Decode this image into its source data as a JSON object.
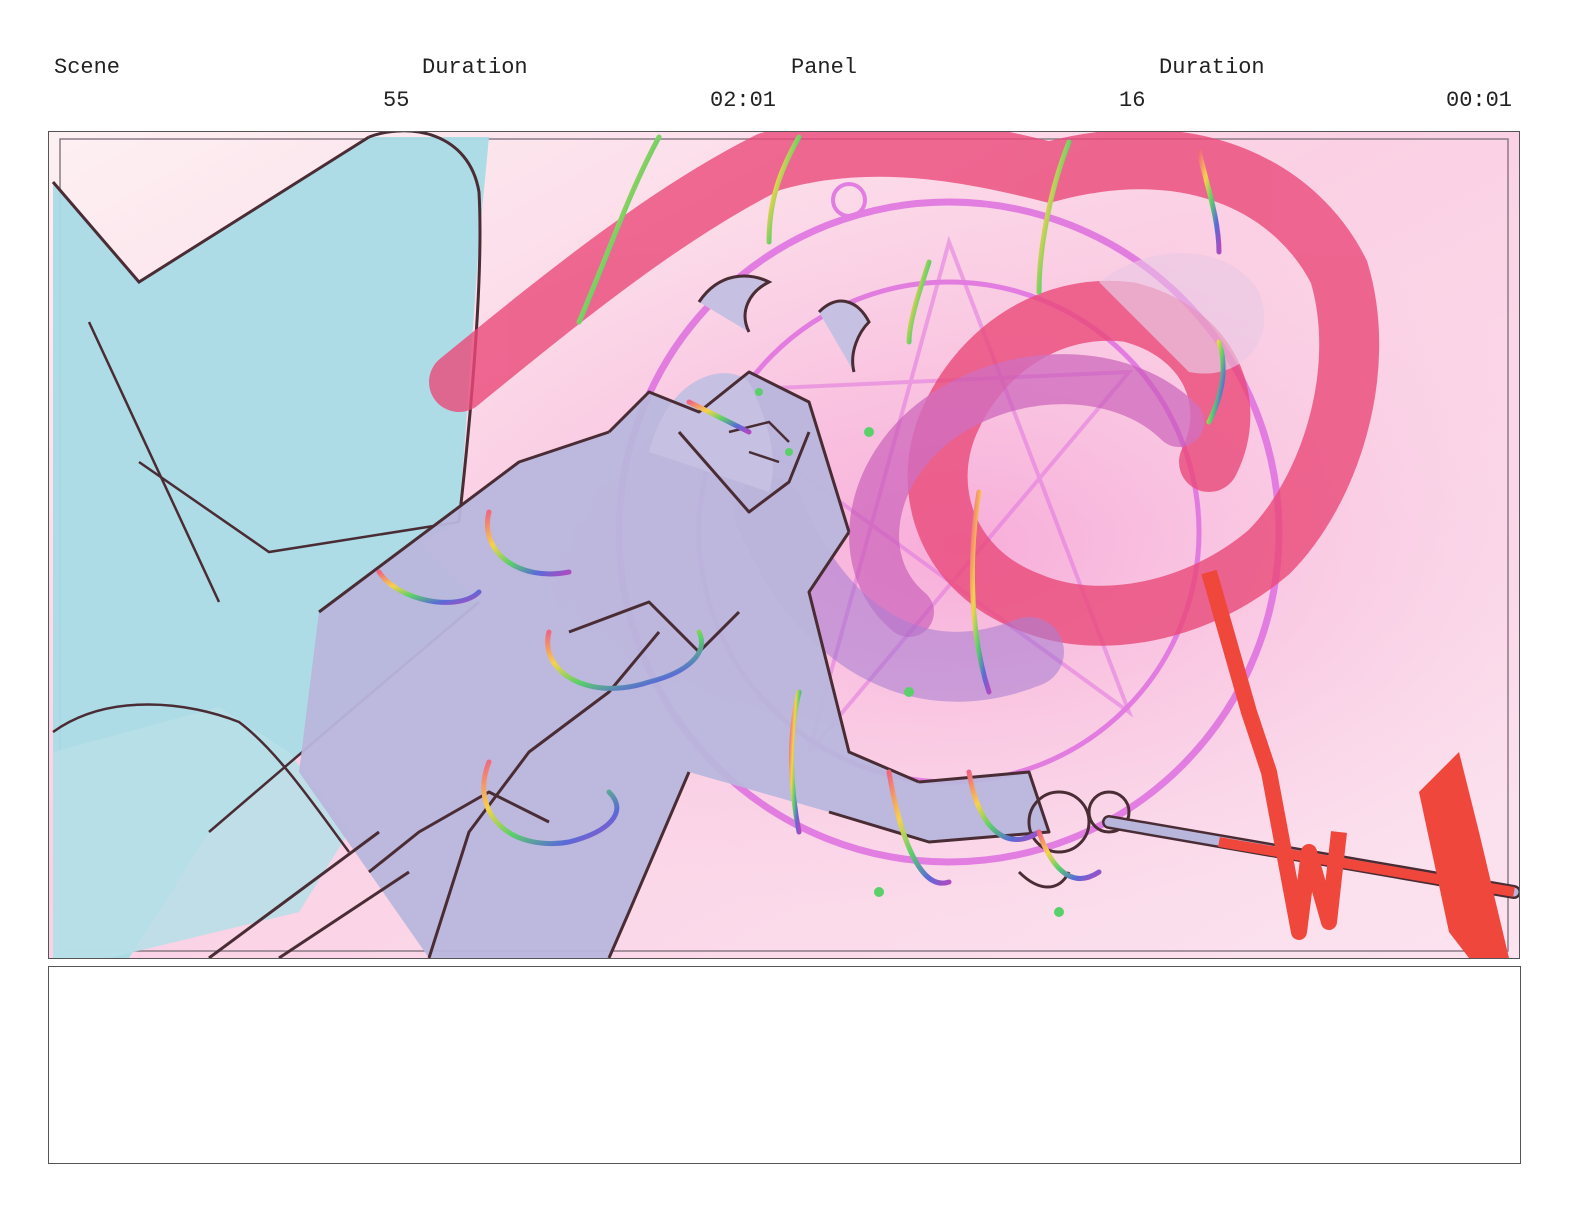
{
  "header": {
    "scene_label": "Scene",
    "scene_value": "55",
    "duration_label": "Duration",
    "duration_value": "02:01",
    "panel_label": "Panel",
    "panel_value": "16",
    "panel_duration_label": "Duration",
    "panel_duration_value": "00:01"
  },
  "panel_image": {
    "palette": {
      "sky_top": "#fde3ec",
      "sky_mid": "#f9c2dd",
      "wing": "#a9dbe6",
      "figure": "#b9b6dc",
      "magic_circle": "#de6fe0",
      "swirl": "#ea4a7a",
      "spear": "#f0473d",
      "line": "#4a2c35"
    }
  },
  "notes": {
    "text": ""
  }
}
